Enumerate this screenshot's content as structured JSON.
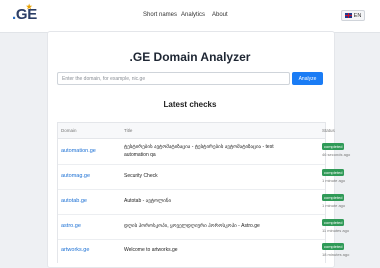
{
  "brand": {
    "logo_prefix": ".",
    "logo_suffix": "GE",
    "logo_star": "★"
  },
  "nav": {
    "items": [
      "Short names",
      "Analytics",
      "About"
    ]
  },
  "language": {
    "code": "EN"
  },
  "main": {
    "title": ".GE Domain Analyzer",
    "search_placeholder": "Enter the domain, for example, nic.ge",
    "analyze_label": "Analyze",
    "latest_heading": "Latest checks"
  },
  "table": {
    "columns": [
      "Domain",
      "Title",
      "Status"
    ],
    "rows": [
      {
        "domain": "automation.ge",
        "title": "ტესტირების ავტომატიზაცია - ტესტირების ავტომატიზაცია - test automation qa",
        "status": "completed",
        "ago": "46 seconds ago"
      },
      {
        "domain": "automag.ge",
        "title": "Security Check",
        "status": "completed",
        "ago": "1 minute ago"
      },
      {
        "domain": "autotab.ge",
        "title": "Autotab - ავტოლინი",
        "status": "completed",
        "ago": "1 minute ago"
      },
      {
        "domain": "astro.ge",
        "title": "დღის ჰოროსკოპი, ყოველდღიური ჰოროსკოპი - Astro.ge",
        "status": "completed",
        "ago": "11 minutes ago"
      },
      {
        "domain": "artworks.ge",
        "title": "Welcome to artworks.ge",
        "status": "completed",
        "ago": "18 minutes ago"
      }
    ]
  },
  "colors": {
    "accent": "#1a7cf5",
    "link": "#1a6fd4",
    "success": "#2f9a57",
    "brand": "#2c3e66"
  },
  "icons": {
    "language_flag": "uk-flag-icon"
  }
}
